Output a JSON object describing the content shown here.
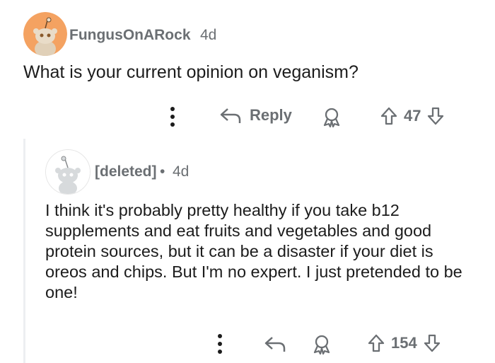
{
  "top_comment": {
    "username": "FungusOnARock",
    "time": "4d",
    "text": "What is your current opinion on veganism?",
    "actions": {
      "more_icon": "vertical-dots-icon",
      "reply_label": "Reply",
      "award_icon": "award-icon",
      "vote_count": "47"
    }
  },
  "reply": {
    "username": "[deleted]",
    "separator": "•",
    "time": "4d",
    "text": "I think it's probably pretty healthy if you take b12 supplements and eat fruits and vegetables and good protein sources, but it can be a disaster if your diet is oreos and chips. But I'm no expert. I just pretended to be one!",
    "actions": {
      "more_icon": "vertical-dots-icon",
      "reply_icon": "reply-arrow-icon",
      "award_icon": "award-icon",
      "vote_count": "154"
    }
  },
  "colors": {
    "avatar_orange": "#f4a261",
    "avatar_grey": "#d7dadc",
    "meta_text": "#6b6f73",
    "thread_line": "#edeff1"
  }
}
